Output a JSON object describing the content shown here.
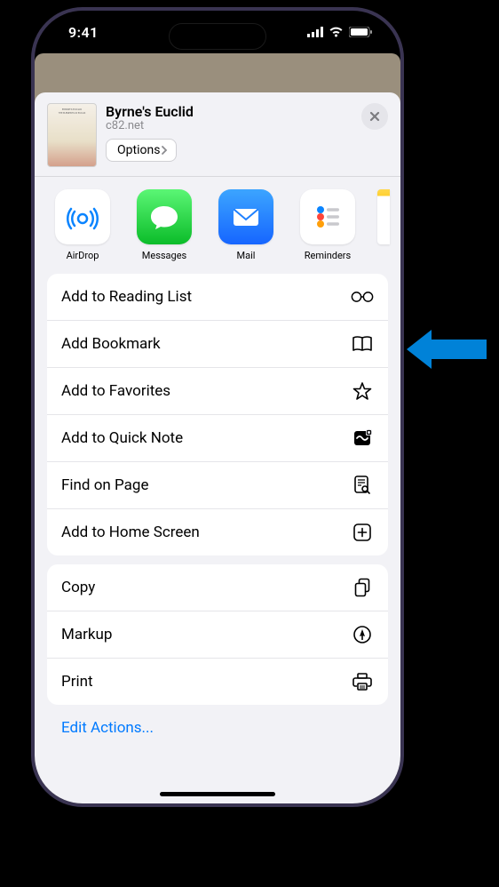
{
  "status": {
    "time": "9:41"
  },
  "header": {
    "title": "Byrne's Euclid",
    "subtitle": "c82.net",
    "options_label": "Options"
  },
  "share_targets": [
    {
      "name": "airdrop",
      "label": "AirDrop",
      "bg": "#ffffff"
    },
    {
      "name": "messages",
      "label": "Messages",
      "bg": "linear-gradient(180deg,#5bf675,#0bbc29)"
    },
    {
      "name": "mail",
      "label": "Mail",
      "bg": "linear-gradient(180deg,#1e90ff,#0062e4)"
    },
    {
      "name": "reminders",
      "label": "Reminders",
      "bg": "#ffffff"
    }
  ],
  "actions_primary": [
    {
      "id": "reading-list",
      "label": "Add to Reading List",
      "icon": "glasses-icon"
    },
    {
      "id": "bookmark",
      "label": "Add Bookmark",
      "icon": "book-icon"
    },
    {
      "id": "favorites",
      "label": "Add to Favorites",
      "icon": "star-icon"
    },
    {
      "id": "quick-note",
      "label": "Add to Quick Note",
      "icon": "quicknote-icon"
    },
    {
      "id": "find",
      "label": "Find on Page",
      "icon": "find-icon"
    },
    {
      "id": "home-screen",
      "label": "Add to Home Screen",
      "icon": "plus-box-icon"
    }
  ],
  "actions_secondary": [
    {
      "id": "copy",
      "label": "Copy",
      "icon": "copy-icon"
    },
    {
      "id": "markup",
      "label": "Markup",
      "icon": "markup-icon"
    },
    {
      "id": "print",
      "label": "Print",
      "icon": "print-icon"
    }
  ],
  "footer": {
    "edit_actions": "Edit Actions..."
  }
}
